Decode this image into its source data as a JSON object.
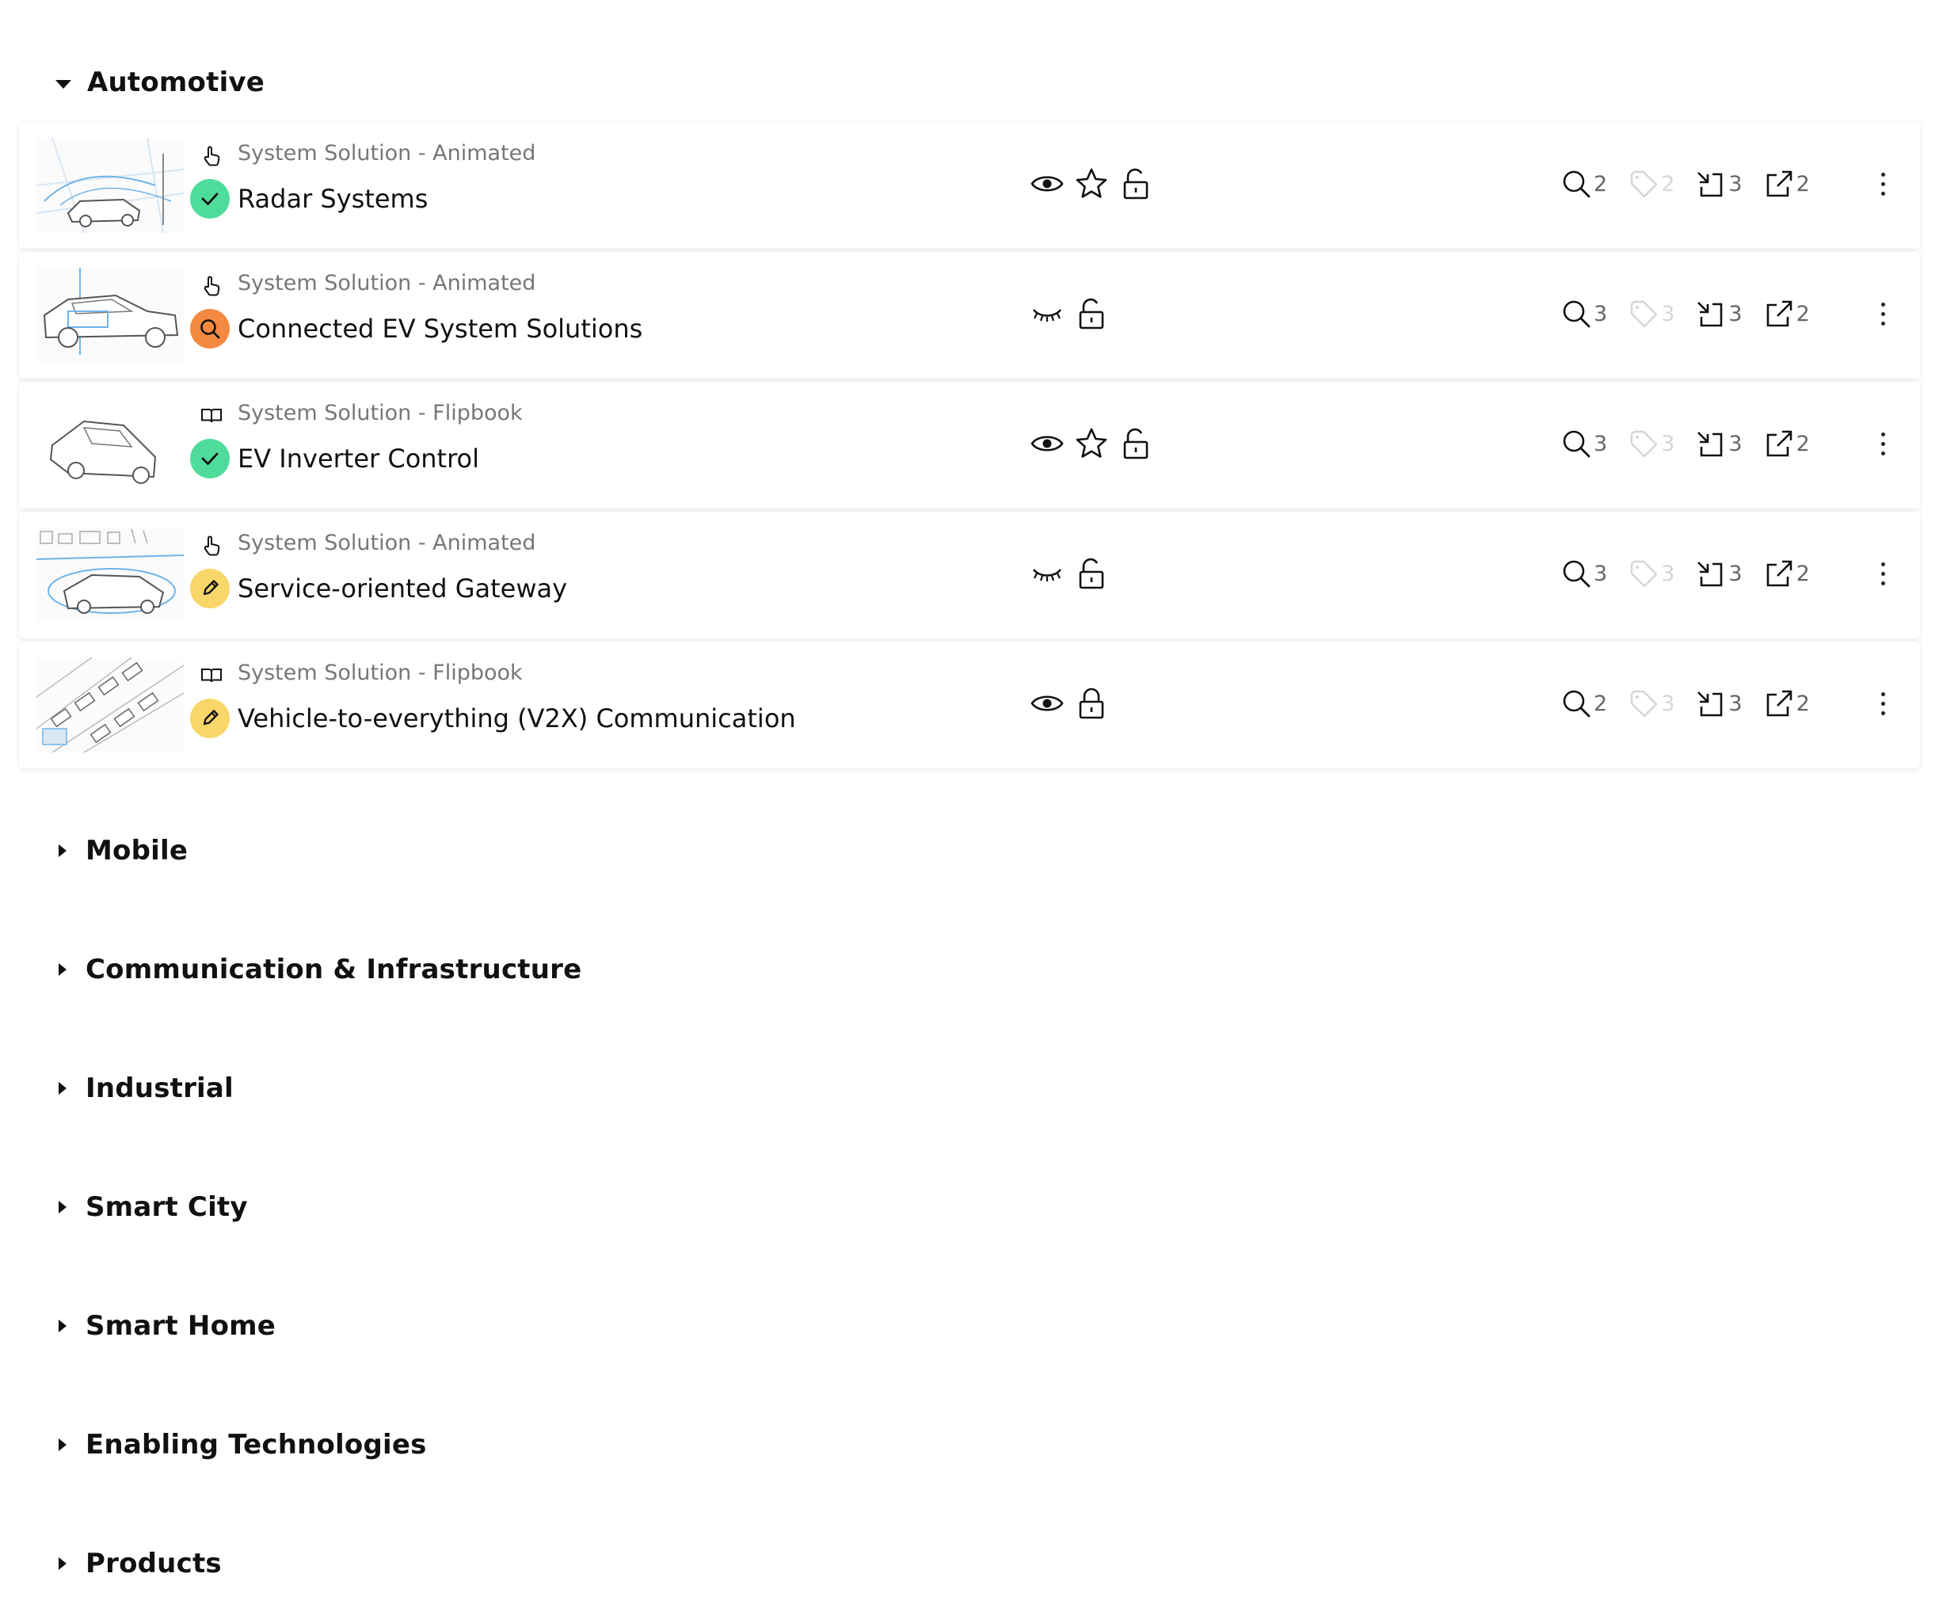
{
  "categories": [
    {
      "label": "Automotive",
      "expanded": true
    },
    {
      "label": "Mobile",
      "expanded": false
    },
    {
      "label": "Communication & Infrastructure",
      "expanded": false
    },
    {
      "label": "Industrial",
      "expanded": false
    },
    {
      "label": "Smart City",
      "expanded": false
    },
    {
      "label": "Smart Home",
      "expanded": false
    },
    {
      "label": "Enabling Technologies",
      "expanded": false
    },
    {
      "label": "Products",
      "expanded": false
    }
  ],
  "items": [
    {
      "type": "System Solution - Animated",
      "type_icon": "hand-pointer-icon",
      "title": "Radar Systems",
      "status": "approved",
      "status_icon": "check-icon",
      "visibility": "visible",
      "favorite": true,
      "lock": "unlocked",
      "searches": "2",
      "tags": "2",
      "imports": "3",
      "exports": "2"
    },
    {
      "type": "System Solution - Animated",
      "type_icon": "hand-pointer-icon",
      "title": "Connected EV System Solutions",
      "status": "in-review",
      "status_icon": "search-icon",
      "visibility": "hidden",
      "favorite": false,
      "lock": "unlocked",
      "searches": "3",
      "tags": "3",
      "imports": "3",
      "exports": "2"
    },
    {
      "type": "System Solution - Flipbook",
      "type_icon": "book-icon",
      "title": "EV Inverter Control",
      "status": "approved",
      "status_icon": "check-icon",
      "visibility": "visible",
      "favorite": true,
      "lock": "unlocked",
      "searches": "3",
      "tags": "3",
      "imports": "3",
      "exports": "2"
    },
    {
      "type": "System Solution - Animated",
      "type_icon": "hand-pointer-icon",
      "title": "Service-oriented Gateway",
      "status": "draft",
      "status_icon": "pencil-icon",
      "visibility": "hidden",
      "favorite": false,
      "lock": "unlocked",
      "searches": "3",
      "tags": "3",
      "imports": "3",
      "exports": "2"
    },
    {
      "type": "System Solution - Flipbook",
      "type_icon": "book-icon",
      "title": "Vehicle-to-everything (V2X) Communication",
      "status": "draft",
      "status_icon": "pencil-icon",
      "visibility": "visible",
      "favorite": false,
      "lock": "locked",
      "searches": "2",
      "tags": "3",
      "imports": "3",
      "exports": "2"
    }
  ],
  "colors": {
    "approved": "#4fdc9b",
    "in_review": "#f28a42",
    "draft": "#f8d66a",
    "muted_icon": "#d5d5d5"
  }
}
